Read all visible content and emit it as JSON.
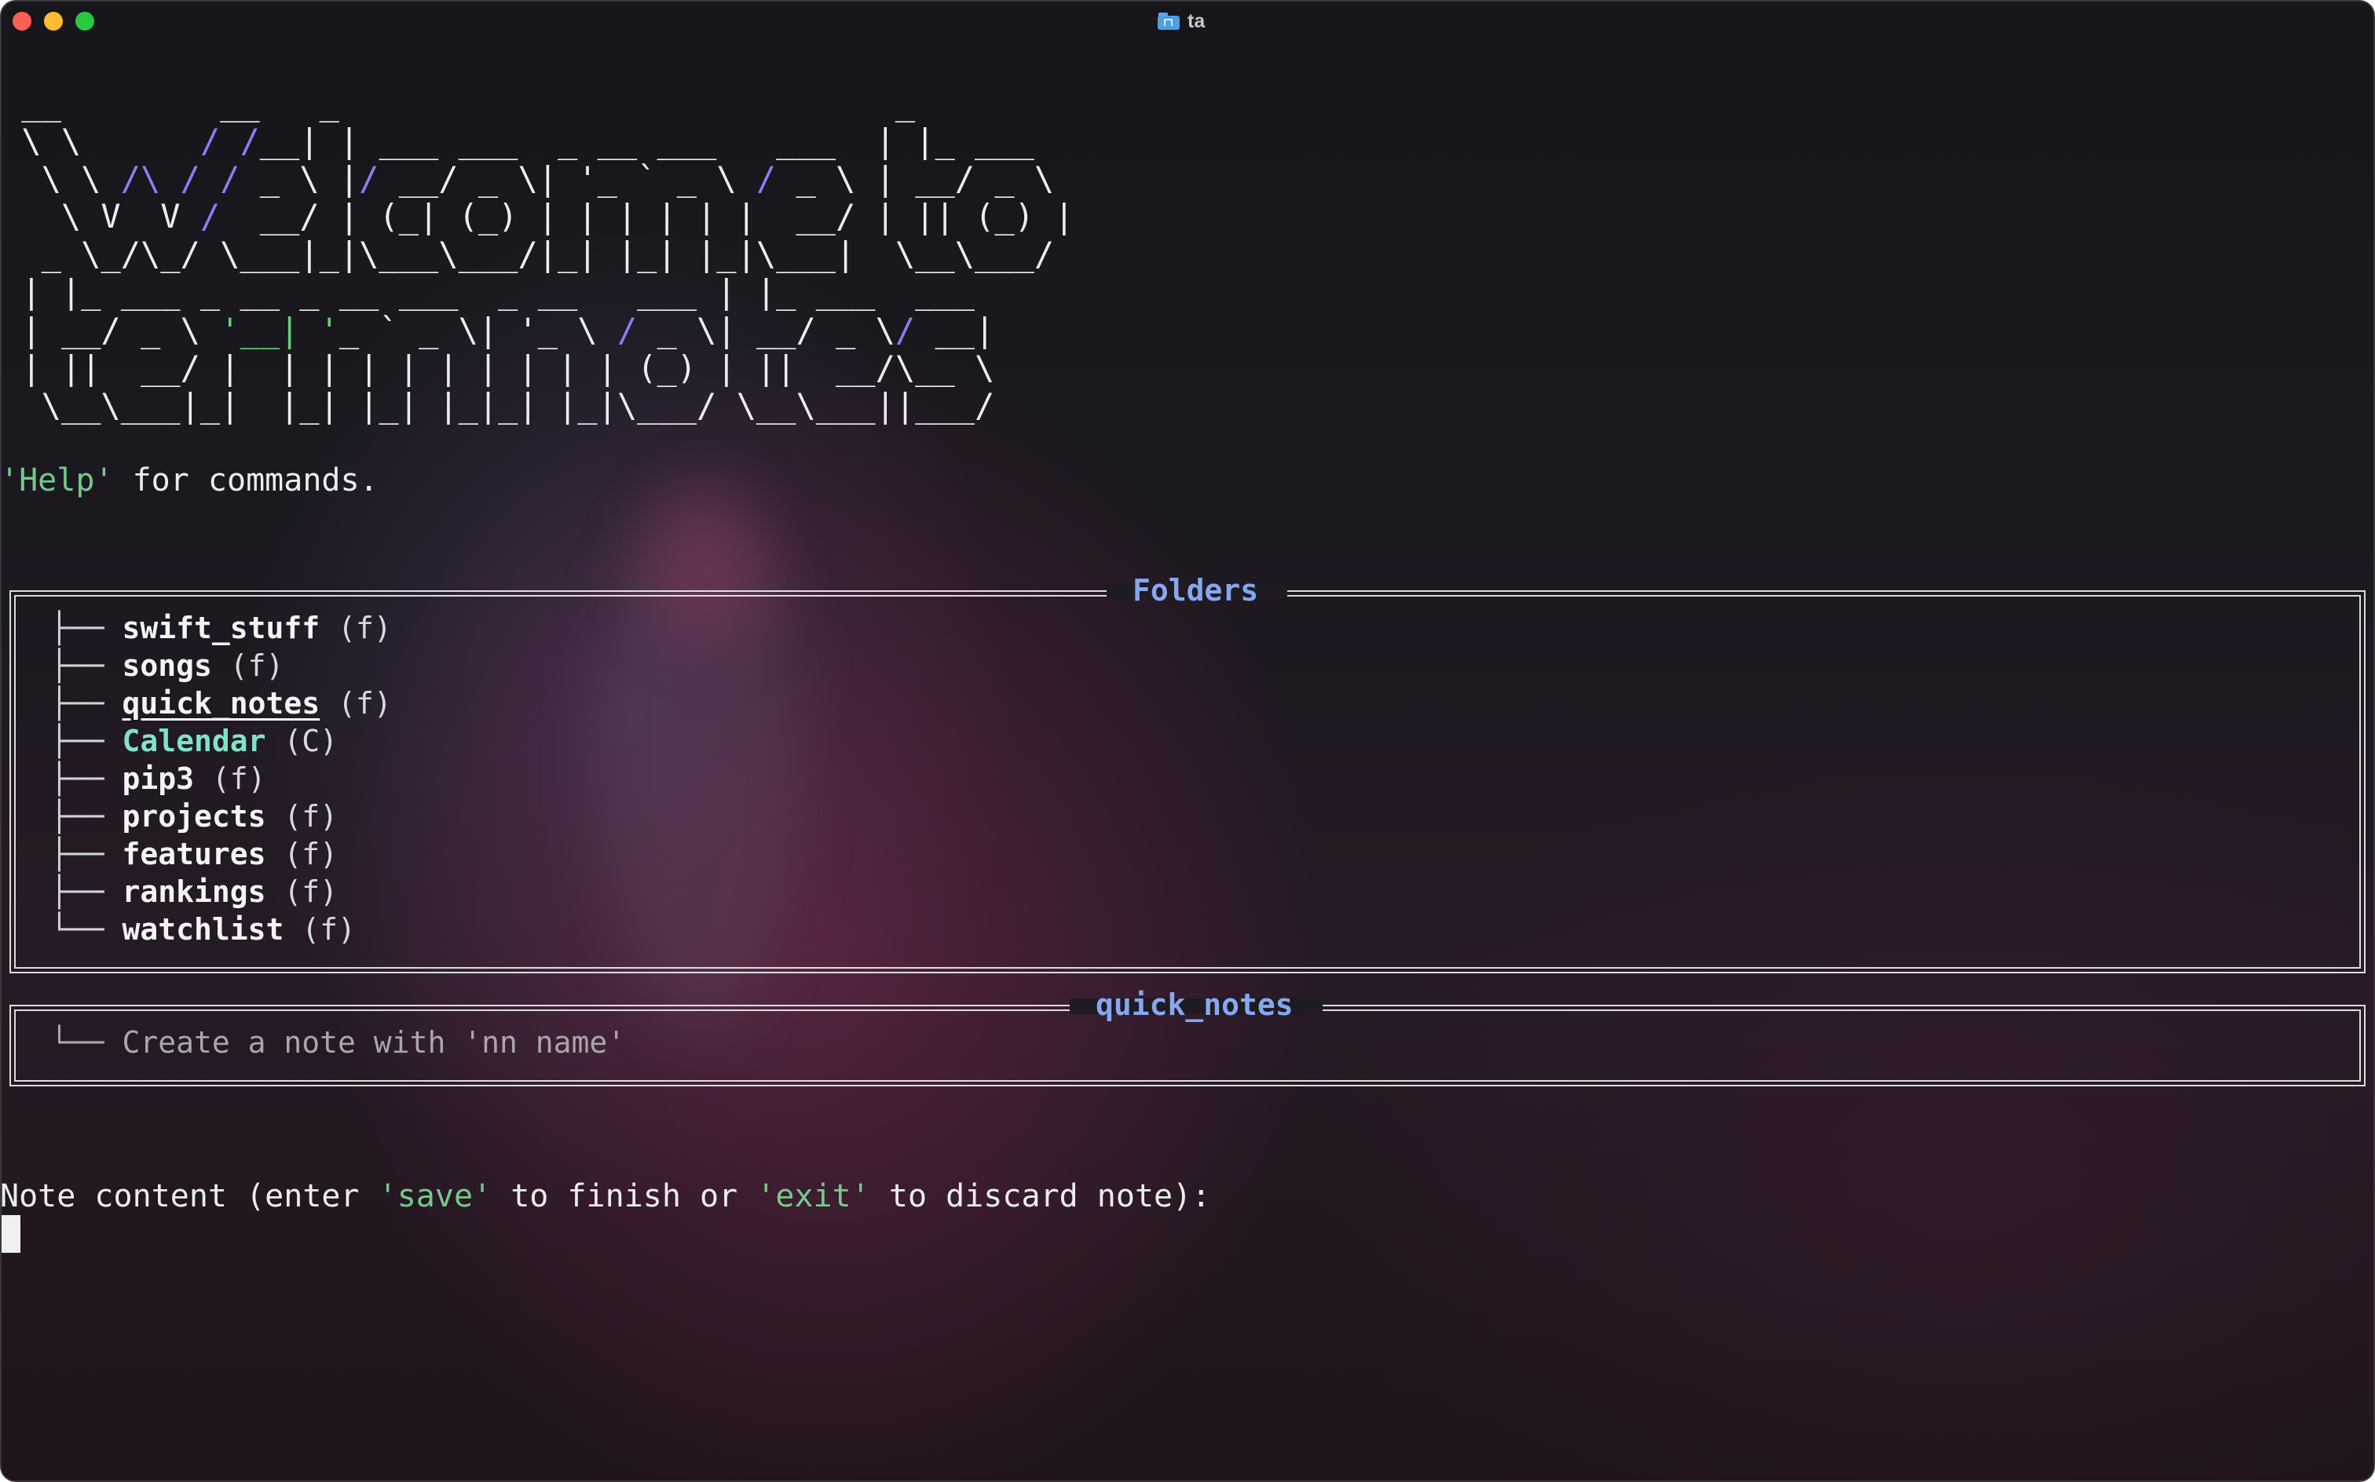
{
  "window": {
    "title": "ta",
    "folder_icon": "folder-icon"
  },
  "banner": {
    "lines": [
      [
        {
          "t": " __        __   _                            _        "
        }
      ],
      [
        {
          "t": " \\ \\      "
        },
        {
          "t": "/ /",
          "c": "p"
        },
        {
          "t": "__| | ___ ___  _ __ ___   ___  | |_ ___  "
        }
      ],
      [
        {
          "t": "  \\ \\ "
        },
        {
          "t": "/\\ / /",
          "c": "p"
        },
        {
          "t": " _ \\ |"
        },
        {
          "t": "/",
          "c": "p"
        },
        {
          "t": " __/ _ \\| '_ ` _ \\ "
        },
        {
          "t": "/",
          "c": "p"
        },
        {
          "t": " _ \\ | __/ _ \\ "
        }
      ],
      [
        {
          "t": "   \\ V  V "
        },
        {
          "t": "/",
          "c": "p"
        },
        {
          "t": "  __/ | (_| (_) | | | | | |  __/ | || (_) |"
        }
      ],
      [
        {
          "t": "  _ \\_/\\_/ \\___|_|\\___\\___/|_| |_| |_|\\___|  \\__\\___/ "
        }
      ],
      [
        {
          "t": " | |_ ___ _ __ _ __ ___  _ __   ___ | |_ ___  ___  "
        }
      ],
      [
        {
          "t": " | __/ _ \\ "
        },
        {
          "t": "'__| '",
          "c": "g"
        },
        {
          "t": "_ ` _ \\| '_ \\ "
        },
        {
          "t": "/",
          "c": "p"
        },
        {
          "t": " _ \\| __/ _ \\"
        },
        {
          "t": "/",
          "c": "p"
        },
        {
          "t": " __| "
        }
      ],
      [
        {
          "t": " | ||  __/ |  | | | | | | | | | (_) | ||  __/\\__ \\ "
        }
      ],
      [
        {
          "t": "  \\__\\___|_|  |_| |_| |_|_| |_|\\___/ \\__\\___||___/ "
        }
      ]
    ]
  },
  "help": {
    "keyword": "'Help'",
    "rest": " for commands."
  },
  "folders_panel": {
    "title": "Folders",
    "items": [
      {
        "branch": "├── ",
        "name": "swift_stuff",
        "type": " (f)",
        "style": ""
      },
      {
        "branch": "├── ",
        "name": "songs",
        "type": " (f)",
        "style": ""
      },
      {
        "branch": "├── ",
        "name": "quick_notes",
        "type": " (f)",
        "style": "underline"
      },
      {
        "branch": "├── ",
        "name": "Calendar",
        "type": " (C)",
        "style": "cyan"
      },
      {
        "branch": "├── ",
        "name": "pip3",
        "type": " (f)",
        "style": ""
      },
      {
        "branch": "├── ",
        "name": "projects",
        "type": " (f)",
        "style": ""
      },
      {
        "branch": "├── ",
        "name": "features",
        "type": " (f)",
        "style": ""
      },
      {
        "branch": "├── ",
        "name": "rankings",
        "type": " (f)",
        "style": ""
      },
      {
        "branch": "└── ",
        "name": "watchlist",
        "type": " (f)",
        "style": ""
      }
    ]
  },
  "notes_panel": {
    "title": "quick_notes",
    "branch": "└── ",
    "hint": "Create a note with 'nn name'"
  },
  "prompt": {
    "p1": "Note content (enter ",
    "save": "'save'",
    "p2": " to finish or ",
    "exit": "'exit'",
    "p3": " to discard note):"
  },
  "colors": {
    "accent_title": "#86a7f0",
    "keyword_green": "#74c98a",
    "calendar_cyan": "#7fe3c8",
    "art_purple": "#8f7bf5"
  }
}
